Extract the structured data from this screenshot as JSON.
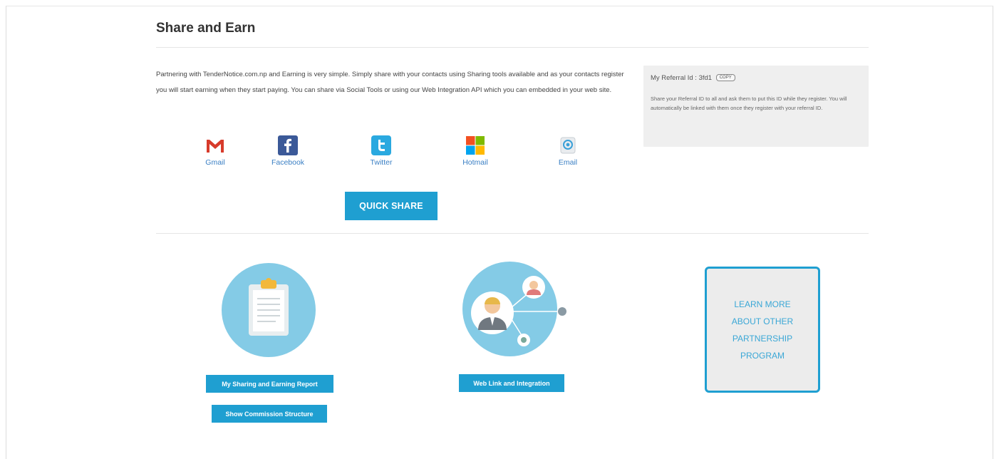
{
  "page": {
    "title": "Share and Earn"
  },
  "intro": {
    "text": "Partnering with TenderNotice.com.np and Earning is very simple. Simply share with your contacts using Sharing tools available and as your contacts register you will start earning when they start paying. You can share via Social Tools or using our Web Integration API which you can embedded in your web site."
  },
  "share": {
    "items": [
      {
        "label": "Gmail",
        "icon": "gmail-icon"
      },
      {
        "label": "Facebook",
        "icon": "facebook-icon"
      },
      {
        "label": "Twitter",
        "icon": "twitter-icon"
      },
      {
        "label": "Hotmail",
        "icon": "hotmail-icon"
      },
      {
        "label": "Email",
        "icon": "email-icon"
      }
    ],
    "quick_share_label": "QUICK SHARE"
  },
  "referral": {
    "label": "My Referral Id : ",
    "id": "3fd1",
    "copy_label": "COPY",
    "description": "Share your Referral ID to all and ask them to put this ID while they register. You will automatically be linked with them once they register with your referral ID."
  },
  "actions": {
    "report_button": "My Sharing and Earning Report",
    "commission_button": "Show Commission Structure",
    "web_link_button": "Web Link and Integration",
    "learn_more_text": "LEARN MORE ABOUT OTHER PARTNERSHIP PROGRAM"
  },
  "colors": {
    "accent": "#1f9fd1",
    "circle": "#84cbe6",
    "link": "#3a7fc4"
  }
}
